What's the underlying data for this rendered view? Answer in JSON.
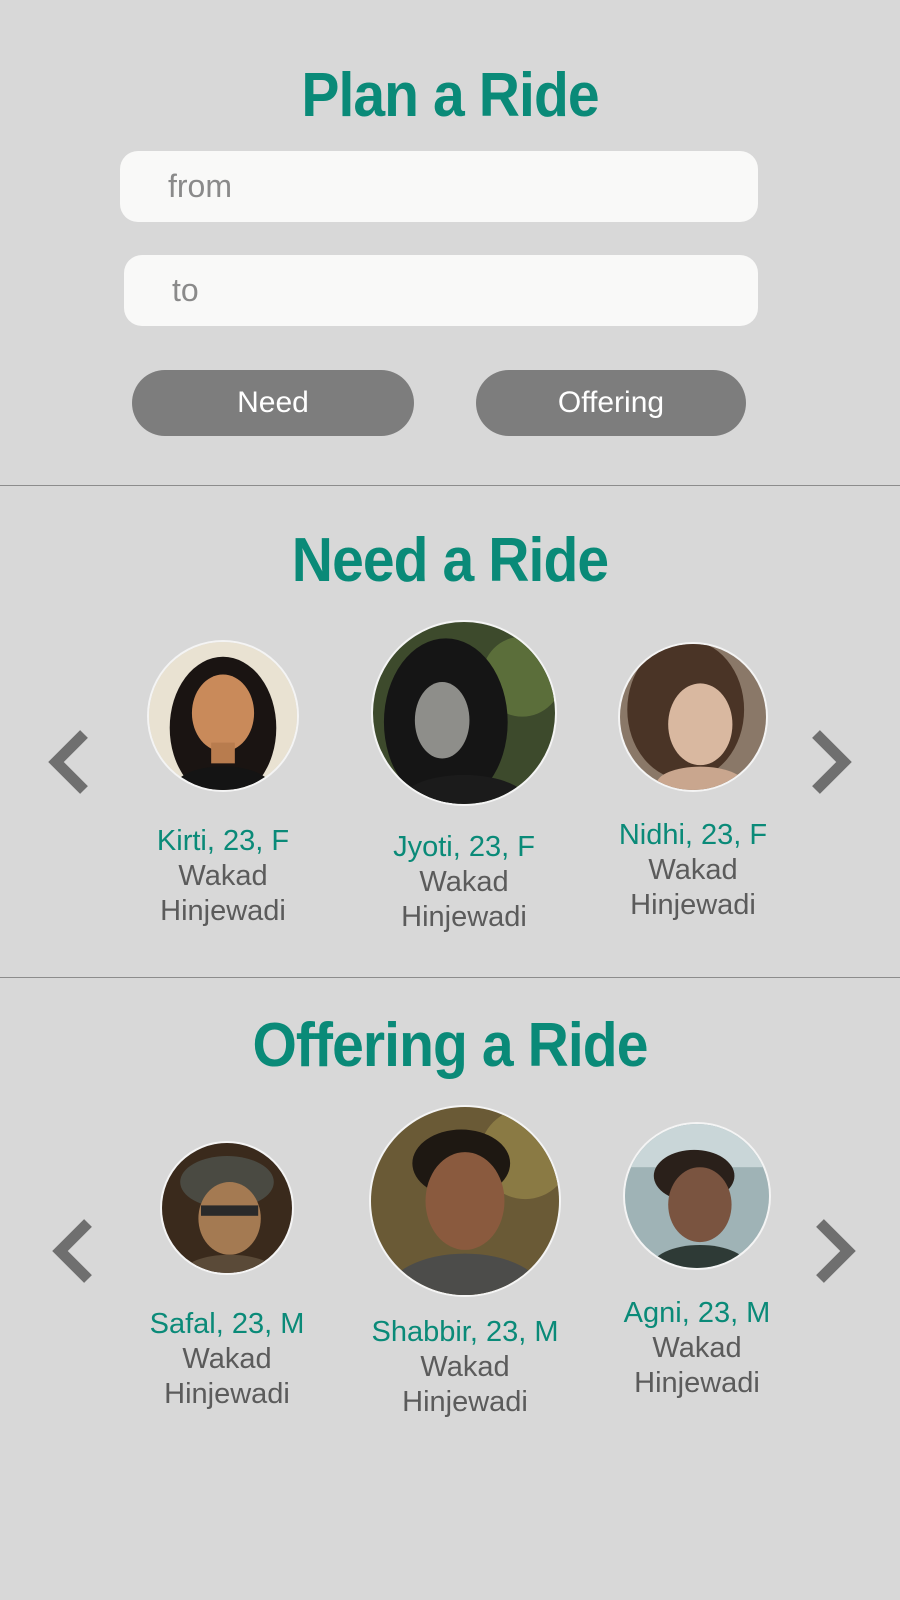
{
  "plan": {
    "title": "Plan a Ride",
    "from_placeholder": "from",
    "to_placeholder": "to",
    "need_label": "Need",
    "offering_label": "Offering"
  },
  "need": {
    "title": "Need a Ride",
    "profiles": [
      {
        "name": "Kirti, 23, F",
        "from": "Wakad",
        "to": "Hinjewadi"
      },
      {
        "name": "Jyoti, 23, F",
        "from": "Wakad",
        "to": "Hinjewadi"
      },
      {
        "name": "Nidhi, 23, F",
        "from": "Wakad",
        "to": "Hinjewadi"
      }
    ]
  },
  "offering": {
    "title": "Offering a Ride",
    "profiles": [
      {
        "name": "Safal, 23, M",
        "from": "Wakad",
        "to": "Hinjewadi"
      },
      {
        "name": "Shabbir, 23, M",
        "from": "Wakad",
        "to": "Hinjewadi"
      },
      {
        "name": "Agni, 23, M",
        "from": "Wakad",
        "to": "Hinjewadi"
      }
    ]
  },
  "icons": {
    "prev": "chevron-left-icon",
    "next": "chevron-right-icon",
    "avatar": "avatar-photo"
  },
  "colors": {
    "accent": "#0a8a78",
    "background": "#d8d8d8",
    "button": "#7d7d7d",
    "input": "#f9f9f8",
    "secondary_text": "#5b5b5b"
  }
}
